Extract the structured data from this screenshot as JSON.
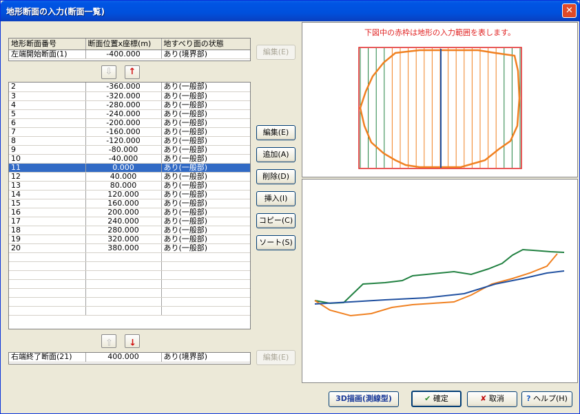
{
  "window": {
    "title": "地形断面の入力(断面一覧)",
    "close_glyph": "✕"
  },
  "top_grid": {
    "headers": [
      "地形断面番号",
      "断面位置x座標(m)",
      "地すべり面の状態"
    ],
    "row": [
      "左端開始断面(1)",
      "-400.000",
      "あり(境界部)"
    ]
  },
  "edit_top_label": "編集(E)",
  "arrows": {
    "down": "⇩",
    "up": "↑"
  },
  "main_rows": [
    [
      "2",
      "-360.000",
      "あり(一般部)"
    ],
    [
      "3",
      "-320.000",
      "あり(一般部)"
    ],
    [
      "4",
      "-280.000",
      "あり(一般部)"
    ],
    [
      "5",
      "-240.000",
      "あり(一般部)"
    ],
    [
      "6",
      "-200.000",
      "あり(一般部)"
    ],
    [
      "7",
      "-160.000",
      "あり(一般部)"
    ],
    [
      "8",
      "-120.000",
      "あり(一般部)"
    ],
    [
      "9",
      "-80.000",
      "あり(一般部)"
    ],
    [
      "10",
      "-40.000",
      "あり(一般部)"
    ],
    [
      "11",
      "0.000",
      "あり(一般部)"
    ],
    [
      "12",
      "40.000",
      "あり(一般部)"
    ],
    [
      "13",
      "80.000",
      "あり(一般部)"
    ],
    [
      "14",
      "120.000",
      "あり(一般部)"
    ],
    [
      "15",
      "160.000",
      "あり(一般部)"
    ],
    [
      "16",
      "200.000",
      "あり(一般部)"
    ],
    [
      "17",
      "240.000",
      "あり(一般部)"
    ],
    [
      "18",
      "280.000",
      "あり(一般部)"
    ],
    [
      "19",
      "320.000",
      "あり(一般部)"
    ],
    [
      "20",
      "380.000",
      "あり(一般部)"
    ]
  ],
  "selected_row": "11",
  "side_buttons": {
    "edit": "編集(E)",
    "add": "追加(A)",
    "delete": "削除(D)",
    "insert": "挿入(I)",
    "copy": "コピー(C)",
    "sort": "ソート(S)"
  },
  "bottom_grid": {
    "row": [
      "右端終了断面(21)",
      "400.000",
      "あり(境界部)"
    ]
  },
  "edit_bottom_label": "編集(E)",
  "plan_caption": "下図中の赤枠は地形の入力範囲を表します。",
  "footer": {
    "draw3d": "3D描画(測線型)",
    "ok": "確定",
    "cancel": "取消",
    "help": "ヘルプ(H)"
  },
  "colors": {
    "accent": "#0054e3",
    "selection": "#316ac5",
    "red_frame": "#e02020",
    "orange": "#f08020",
    "green": "#208040",
    "blue": "#2050a0"
  }
}
